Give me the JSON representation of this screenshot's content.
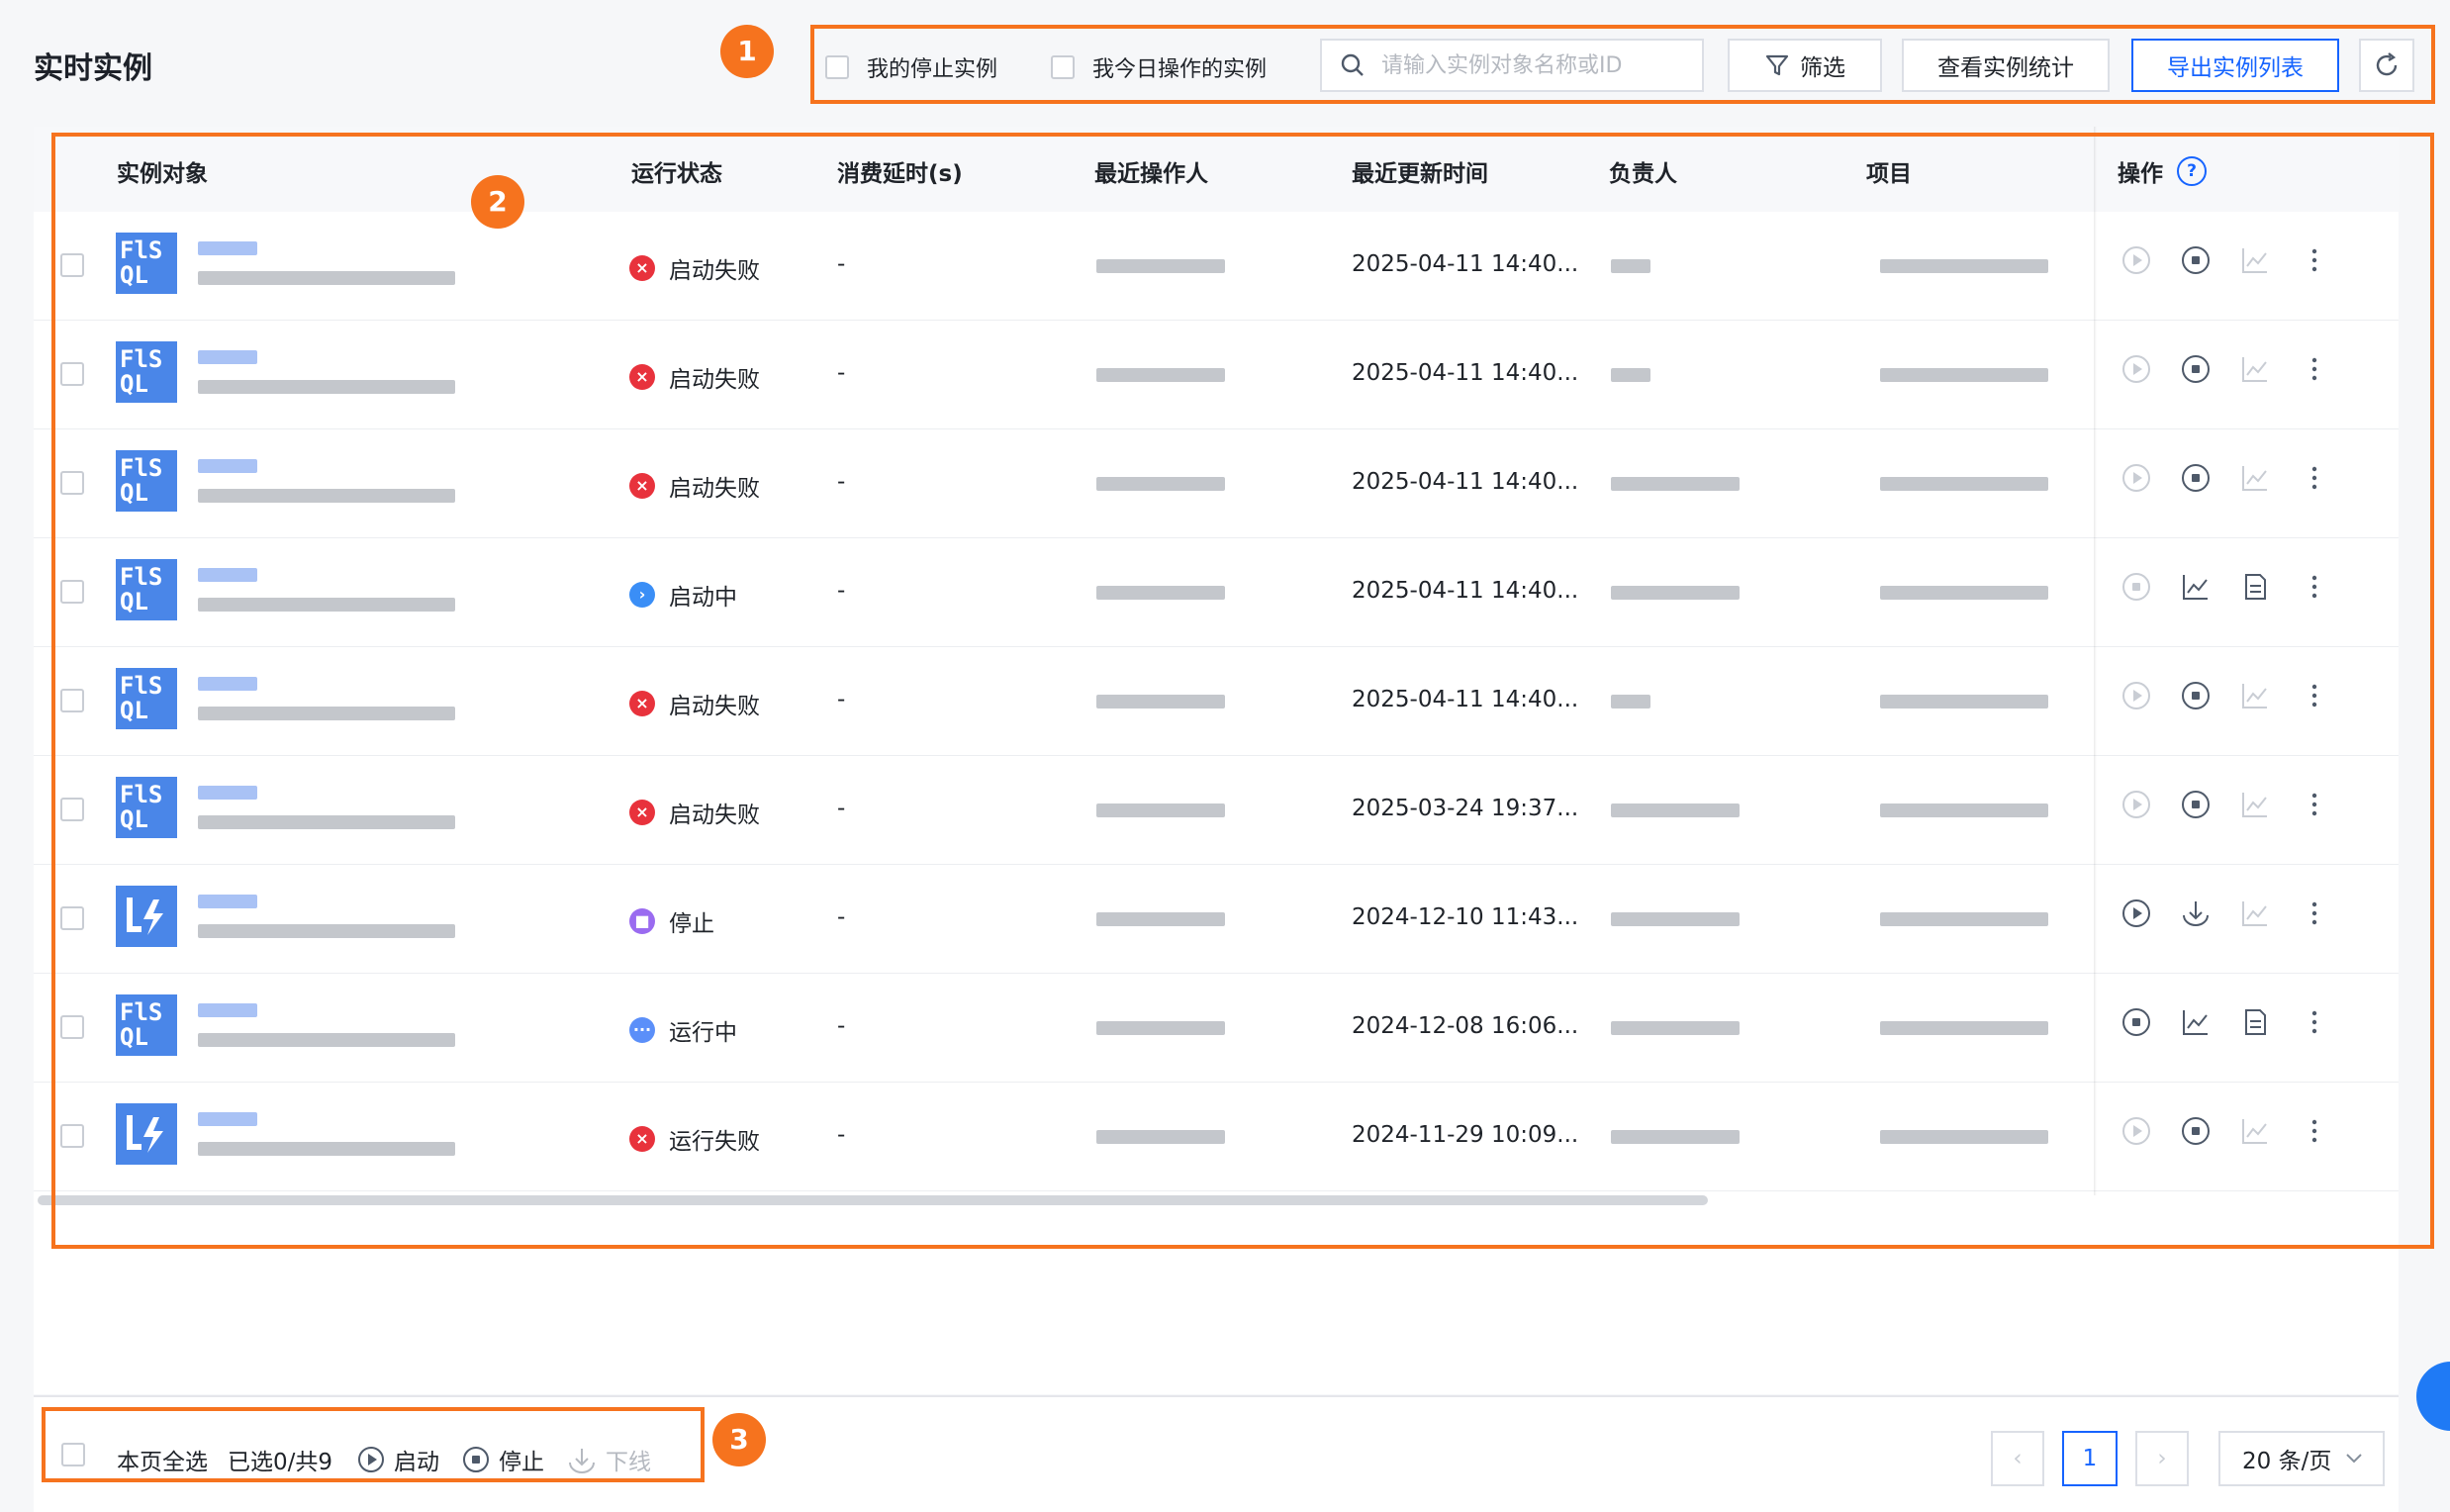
{
  "page_title": "实时实例",
  "toolbar": {
    "check_stopped": "我的停止实例",
    "check_today": "我今日操作的实例",
    "search_placeholder": "请输入实例对象名称或ID",
    "filter_label": "筛选",
    "stats_label": "查看实例统计",
    "export_label": "导出实例列表"
  },
  "markers": [
    "1",
    "2",
    "3"
  ],
  "table": {
    "headers": {
      "object": "实例对象",
      "status": "运行状态",
      "delay": "消费延时(s)",
      "operator": "最近操作人",
      "updated": "最近更新时间",
      "owner": "负责人",
      "project": "项目",
      "actions": "操作"
    },
    "rows": [
      {
        "logo": "FlSQL",
        "status": "启动失败",
        "status_type": "failed",
        "delay": "-",
        "updated": "2025-04-11 14:40..."
      },
      {
        "logo": "FlSQL",
        "status": "启动失败",
        "status_type": "failed",
        "delay": "-",
        "updated": "2025-04-11 14:40..."
      },
      {
        "logo": "FlSQL",
        "status": "启动失败",
        "status_type": "failed",
        "delay": "-",
        "updated": "2025-04-11 14:40..."
      },
      {
        "logo": "FlSQL",
        "status": "启动中",
        "status_type": "starting",
        "delay": "-",
        "updated": "2025-04-11 14:40..."
      },
      {
        "logo": "FlSQL",
        "status": "启动失败",
        "status_type": "failed",
        "delay": "-",
        "updated": "2025-04-11 14:40..."
      },
      {
        "logo": "FlSQL",
        "status": "启动失败",
        "status_type": "failed",
        "delay": "-",
        "updated": "2025-03-24 19:37..."
      },
      {
        "logo": "flink",
        "status": "停止",
        "status_type": "stopped",
        "delay": "-",
        "updated": "2024-12-10 11:43..."
      },
      {
        "logo": "FlSQL",
        "status": "运行中",
        "status_type": "running",
        "delay": "-",
        "updated": "2024-12-08 16:06..."
      },
      {
        "logo": "flink",
        "status": "运行失败",
        "status_type": "failed",
        "delay": "-",
        "updated": "2024-11-29 10:09..."
      }
    ]
  },
  "footer": {
    "select_all": "本页全选",
    "selected": "已选0/共9",
    "start": "启动",
    "stop": "停止",
    "offline": "下线",
    "current_page": "1",
    "page_size": "20 条/页"
  },
  "colors": {
    "accent": "#1664ff",
    "marker": "#f6731e",
    "failed": "#e8323c",
    "starting": "#3a8ef6",
    "stopped": "#9a6bf0",
    "running": "#5b8ff9"
  }
}
